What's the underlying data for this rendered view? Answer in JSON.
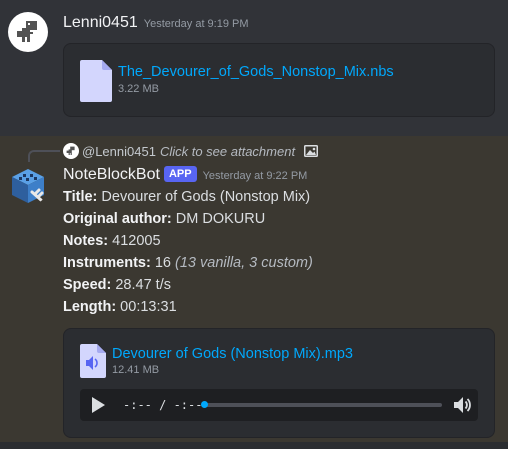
{
  "messages": [
    {
      "author": "Lenni0451",
      "timestamp": "Yesterday at 9:19 PM",
      "attachment": {
        "file_name": "The_Devourer_of_Gods_Nonstop_Mix.nbs",
        "size": "3.22 MB",
        "icon": "file-document-icon"
      }
    },
    {
      "reply": {
        "author": "@Lenni0451",
        "text": "Click to see attachment",
        "icon": "image-icon"
      },
      "author": "NoteBlockBot",
      "badge": "APP",
      "timestamp": "Yesterday at 9:22 PM",
      "fields": [
        {
          "label": "Title:",
          "value": " Devourer of Gods (Nonstop Mix)",
          "extra": ""
        },
        {
          "label": "Original author:",
          "value": " DM DOKURU",
          "extra": ""
        },
        {
          "label": "Notes:",
          "value": " 412005",
          "extra": ""
        },
        {
          "label": "Instruments:",
          "value": " 16 ",
          "extra": "(13 vanilla, 3 custom)"
        },
        {
          "label": "Speed:",
          "value": " 28.47 t/s",
          "extra": ""
        },
        {
          "label": "Length:",
          "value": " 00:13:31",
          "extra": ""
        }
      ],
      "attachment": {
        "file_name": "Devourer of Gods (Nonstop Mix).mp3",
        "size": "12.41 MB",
        "icon": "audio-file-icon",
        "player": {
          "time": "-:-- / -:--",
          "progress": 0
        }
      }
    }
  ],
  "colors": {
    "link": "#00a8fc",
    "badge": "#5865f2",
    "background": "#313338",
    "highlight": "#3b3831"
  }
}
